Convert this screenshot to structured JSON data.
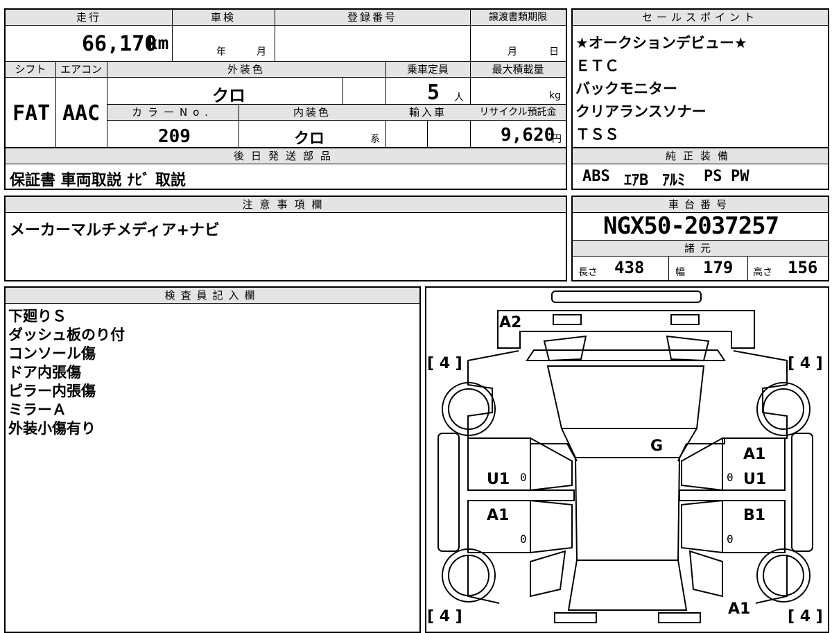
{
  "header": {
    "mileage_label": "走行",
    "shaken_label": "車検",
    "registration_label": "登録番号",
    "transfer_deadline_label": "譲渡書類期限",
    "shift_label": "シフト",
    "aircon_label": "エアコン",
    "exterior_label": "外装色",
    "capacity_label": "乗車定員",
    "max_load_label": "最大積載量",
    "colorno_label": "カラーNo.",
    "interior_label": "内装色",
    "import_label": "輸入車",
    "recycle_label": "リサイクル預託金"
  },
  "vehicle": {
    "mileage": "66,170",
    "mileage_unit": "km",
    "year_unit": "年",
    "month_unit": "月",
    "deadline_month": "月",
    "deadline_day": "日",
    "shift": "FAT",
    "aircon": "AAC",
    "exterior_color": "クロ",
    "capacity": "5",
    "capacity_unit": "人",
    "load_unit": "kg",
    "color_no": "209",
    "interior_color": "クロ",
    "interior_suffix": "系",
    "recycle_fee": "9,620",
    "recycle_unit": "円"
  },
  "later_shipping": {
    "label": "後日発送部品",
    "value": "保証書 車両取説 ﾅﾋﾞ 取説"
  },
  "sales_points": {
    "label": "セールスポイント",
    "items": [
      "★オークションデビュー★",
      "ＥＴＣ",
      "バックモニター",
      "クリアランスソナー",
      "ＴＳＳ"
    ]
  },
  "genuine_equipment": {
    "label": "純正装備",
    "items": [
      "ABS",
      "ｴｱB",
      "ｱﾙﾐ",
      "PS",
      "PW"
    ]
  },
  "notes": {
    "label": "注意事項欄",
    "value": "メーカーマルチメディア+ナビ"
  },
  "chassis": {
    "label": "車台番号",
    "value": "NGX50-2037257"
  },
  "specs": {
    "label": "諸元",
    "length_label": "長さ",
    "length": "438",
    "width_label": "幅",
    "width": "179",
    "height_label": "高さ",
    "height": "156"
  },
  "inspector": {
    "label": "検査員記入欄",
    "lines": [
      "下廻りＳ",
      "ダッシュ板のり付",
      "コンソール傷",
      "ドア内張傷",
      "ピラー内張傷",
      "ミラーＡ",
      "外装小傷有り"
    ]
  },
  "diagram": {
    "tire_front_left": "[ 4 ]",
    "tire_front_right": "[ 4 ]",
    "tire_rear_left": "[ 4 ]",
    "tire_rear_right": "[ 4 ]",
    "front_bumper": "A2",
    "windshield": "G",
    "left_front_door": "U1",
    "left_rear_door": "A1",
    "right_front_door_top": "A1",
    "right_front_door": "U1",
    "right_rear_door": "B1",
    "rear_right": "A1",
    "zero": "0"
  }
}
